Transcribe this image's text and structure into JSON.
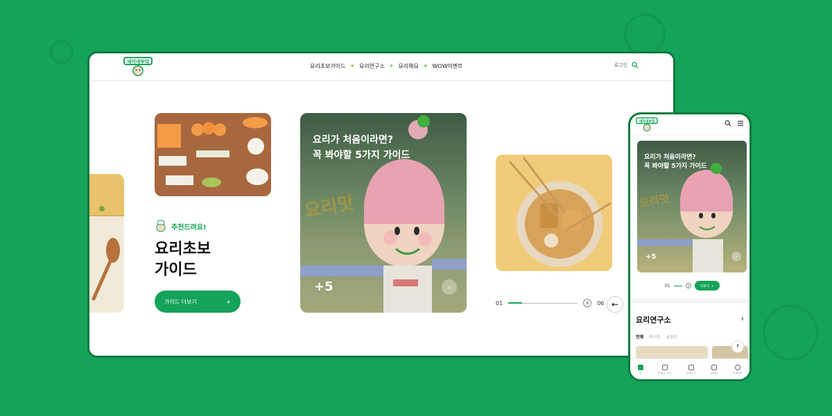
{
  "brand": {
    "accent": "#14a359",
    "accent_dark": "#0c7a3f",
    "background": "#14a359"
  },
  "desktop": {
    "nav": [
      "요리초보가이드",
      "요리연구소",
      "요리해요",
      "WOW이벤트"
    ],
    "nav_separator": "✦",
    "login": "로그인",
    "recommend": "추천드려요!",
    "guide_title_line1": "요리초보",
    "guide_title_line2": "가이드",
    "guide_button": "가이드 더보기",
    "guide_button_icon": "+",
    "card": {
      "title_line1": "요리가 처음이라면?",
      "title_line2": "꼭 봐야할 5가지 가이드",
      "count": "+5"
    },
    "pager": {
      "current": "01",
      "total": "06"
    }
  },
  "mobile": {
    "card": {
      "title_line1": "요리가 처음이라면?",
      "title_line2": "꼭 봐야할 5가지 가이드",
      "count": "+5"
    },
    "pager_current": "01",
    "more_button": "더보기 +",
    "section_title": "요리연구소",
    "tabs": [
      "전체",
      "레시피",
      "솔루션"
    ],
    "bottom_nav": [
      "홈",
      "요리초보 가이드",
      "요리연구소",
      "요리해요",
      "마이페이지"
    ]
  }
}
